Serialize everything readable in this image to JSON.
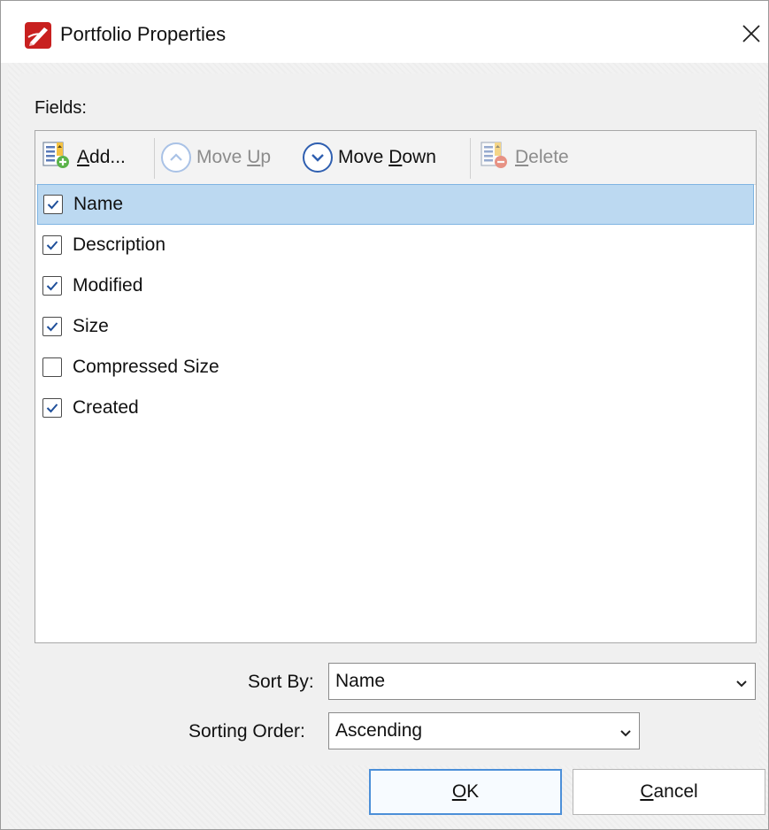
{
  "window": {
    "title": "Portfolio Properties"
  },
  "fields": {
    "label": "Fields:",
    "toolbar": {
      "add": {
        "mnemonic": "A",
        "rest": "dd..."
      },
      "move_up": {
        "before": "Move ",
        "mnemonic": "U",
        "after": "p"
      },
      "move_down": {
        "before": "Move ",
        "mnemonic": "D",
        "after": "own"
      },
      "delete": {
        "mnemonic": "D",
        "rest": "elete"
      }
    },
    "items": [
      {
        "label": "Name",
        "checked": true,
        "selected": true
      },
      {
        "label": "Description",
        "checked": true,
        "selected": false
      },
      {
        "label": "Modified",
        "checked": true,
        "selected": false
      },
      {
        "label": "Size",
        "checked": true,
        "selected": false
      },
      {
        "label": "Compressed Size",
        "checked": false,
        "selected": false
      },
      {
        "label": "Created",
        "checked": true,
        "selected": false
      }
    ]
  },
  "sort_by": {
    "label": "Sort By:",
    "value": "Name"
  },
  "sorting_order": {
    "label": "Sorting Order:",
    "value": "Ascending"
  },
  "buttons": {
    "ok": {
      "mnemonic": "O",
      "rest": "K"
    },
    "cancel": {
      "mnemonic": "C",
      "rest": "ancel"
    }
  },
  "colors": {
    "accent": "#2f5fb0",
    "selection": "#bcd9f1",
    "app_icon": "#c8201f"
  }
}
